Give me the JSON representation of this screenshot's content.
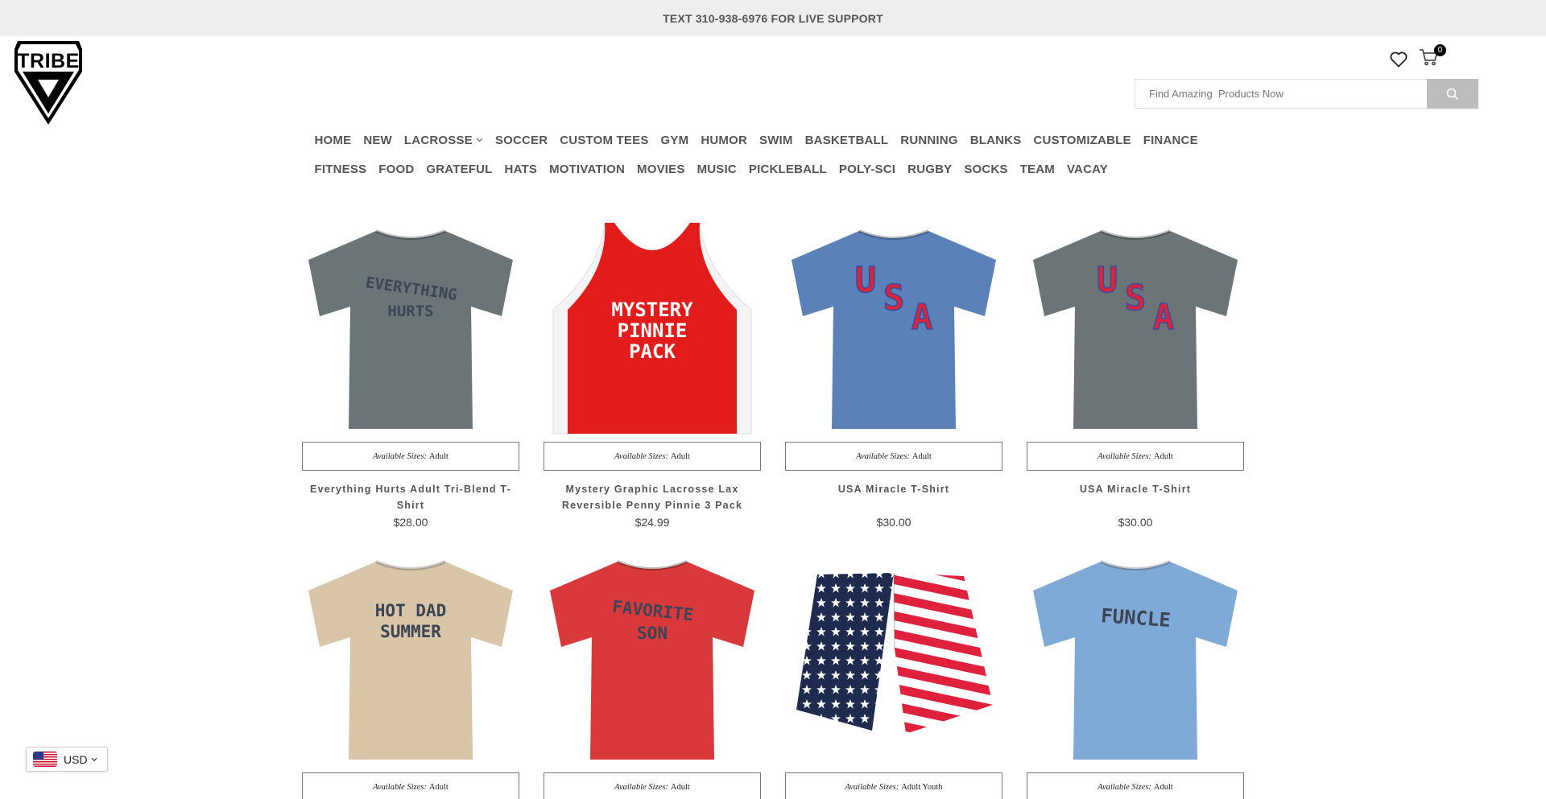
{
  "announcement": "TEXT 310-938-6976 FOR LIVE SUPPORT",
  "logo": {
    "text": "TRIBE"
  },
  "header": {
    "cart_count": "0",
    "search": {
      "placeholder": "Find Amazing  Products Now"
    }
  },
  "nav": {
    "row1": [
      "HOME",
      "NEW",
      "LACROSSE",
      "SOCCER",
      "CUSTOM TEES",
      "GYM",
      "HUMOR",
      "SWIM",
      "BASKETBALL",
      "RUNNING",
      "BLANKS",
      "CUSTOMIZABLE",
      "FINANCE"
    ],
    "row2": [
      "FITNESS",
      "FOOD",
      "GRATEFUL",
      "HATS",
      "MOTIVATION",
      "MOVIES",
      "MUSIC",
      "PICKLEBALL",
      "POLY-SCI",
      "RUGBY",
      "SOCKS",
      "TEAM",
      "VACAY"
    ]
  },
  "products": [
    {
      "sizes_label": "Available Sizes:",
      "sizes": "Adult",
      "title": "Everything Hurts Adult Tri-Blend T-Shirt",
      "price": "$28.00",
      "print": [
        "EVERYTHING",
        "HURTS"
      ],
      "shirt_color": "#6b7577",
      "print_color": "#3b4556"
    },
    {
      "sizes_label": "Available Sizes:",
      "sizes": "Adult",
      "title": "Mystery Graphic Lacrosse Lax Reversible Penny Pinnie 3 Pack",
      "price": "$24.99",
      "print": [
        "MYSTERY",
        "PINNIE",
        "PACK"
      ],
      "shirt_color": "#e21b1b",
      "print_color": "#ffffff"
    },
    {
      "sizes_label": "Available Sizes:",
      "sizes": "Adult",
      "title": "USA Miracle T-Shirt",
      "price": "$30.00",
      "print": [
        "U",
        "S",
        "A"
      ],
      "shirt_color": "#5a82b8",
      "print_color": "#d9243c"
    },
    {
      "sizes_label": "Available Sizes:",
      "sizes": "Adult",
      "title": "USA Miracle T-Shirt",
      "price": "$30.00",
      "print": [
        "U",
        "S",
        "A"
      ],
      "shirt_color": "#6b7577",
      "print_color": "#d9243c"
    },
    {
      "sizes_label": "Available Sizes:",
      "sizes": "Adult",
      "title": "",
      "price": "",
      "print": [
        "HOT DAD",
        "SUMMER"
      ],
      "shirt_color": "#d9c5a8",
      "print_color": "#3b4556"
    },
    {
      "sizes_label": "Available Sizes:",
      "sizes": "Adult",
      "title": "",
      "price": "",
      "print": [
        "FAVORITE",
        "SON"
      ],
      "shirt_color": "#d9393b",
      "print_color": "#3b4556"
    },
    {
      "sizes_label": "Available Sizes:",
      "sizes": "Adult Youth",
      "title": "",
      "price": "",
      "print": [],
      "shirt_color": "#ffffff",
      "print_color": "#1f2a4f"
    },
    {
      "sizes_label": "Available Sizes:",
      "sizes": "Adult",
      "title": "",
      "price": "",
      "print": [
        "FUNCLE"
      ],
      "shirt_color": "#7fa9d6",
      "print_color": "#3b4556"
    }
  ],
  "currency": {
    "code": "USD"
  },
  "colors": {
    "topbar_bg": "#eeeeee",
    "search_button": "#bdbdbd",
    "text": "#555555"
  }
}
